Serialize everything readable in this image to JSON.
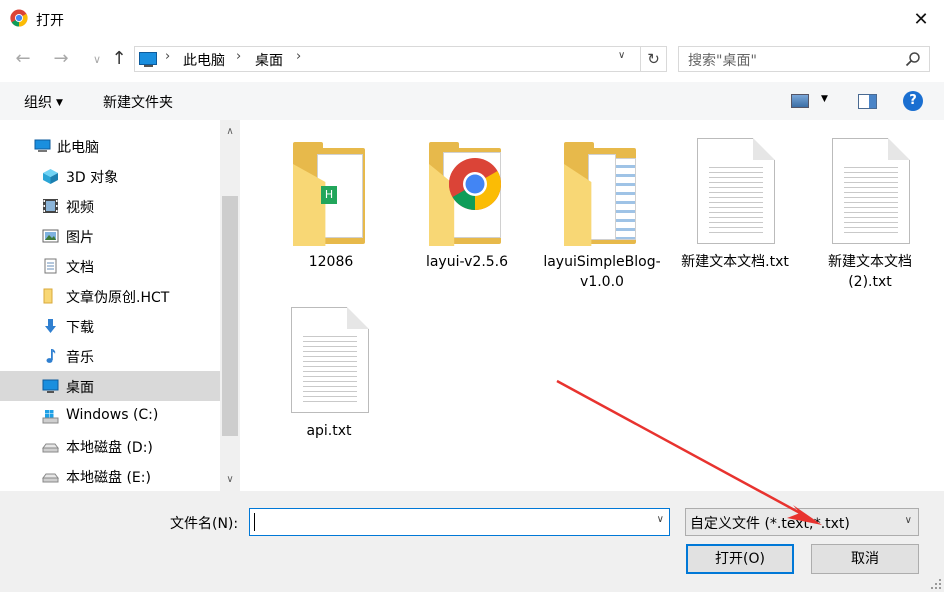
{
  "window": {
    "title": "打开",
    "close_glyph": "✕"
  },
  "nav": {
    "back_glyph": "←",
    "forward_glyph": "→",
    "recent_glyph": "∨",
    "up_glyph": "↑",
    "breadcrumb": [
      "此电脑",
      "桌面"
    ],
    "breadcrumb_sep": "›",
    "refresh_glyph": "↻",
    "dropdown_glyph": "∨",
    "search_placeholder": "搜索\"桌面\""
  },
  "toolbar": {
    "organize_label": "组织",
    "new_folder_label": "新建文件夹",
    "caret_glyph": "▼",
    "help_glyph": "?"
  },
  "sidebar": {
    "items": [
      {
        "label": "此电脑",
        "icon": "computer-icon"
      },
      {
        "label": "3D 对象",
        "icon": "3d-objects-icon"
      },
      {
        "label": "视频",
        "icon": "videos-icon"
      },
      {
        "label": "图片",
        "icon": "pictures-icon"
      },
      {
        "label": "文档",
        "icon": "documents-icon"
      },
      {
        "label": "文章伪原创.HCT",
        "icon": "folder-icon"
      },
      {
        "label": "下载",
        "icon": "downloads-icon"
      },
      {
        "label": "音乐",
        "icon": "music-icon"
      },
      {
        "label": "桌面",
        "icon": "desktop-icon",
        "selected": true
      },
      {
        "label": "Windows (C:)",
        "icon": "windows-drive-icon"
      },
      {
        "label": "本地磁盘 (D:)",
        "icon": "drive-icon"
      },
      {
        "label": "本地磁盘 (E:)",
        "icon": "drive-icon"
      }
    ],
    "scroll_up_glyph": "∧",
    "scroll_down_glyph": "∨"
  },
  "files": [
    {
      "name": "12086",
      "type": "folder"
    },
    {
      "name": "layui-v2.5.6",
      "type": "folder"
    },
    {
      "name": "layuiSimpleBlog-v1.0.0",
      "type": "folder"
    },
    {
      "name": "新建文本文档.txt",
      "type": "txt"
    },
    {
      "name": "新建文本文档 (2).txt",
      "type": "txt"
    },
    {
      "name": "api.txt",
      "type": "txt"
    }
  ],
  "bottom": {
    "filename_label": "文件名(N):",
    "filename_value": "",
    "filetype_value": "自定义文件 (*.text;*.txt)",
    "open_label": "打开(O)",
    "cancel_label": "取消",
    "dropdown_glyph": "∨"
  },
  "colors": {
    "accent": "#0078d7",
    "annotation_arrow": "#e8332f",
    "folder": "#f8d775",
    "selection": "#d9d9d9"
  }
}
